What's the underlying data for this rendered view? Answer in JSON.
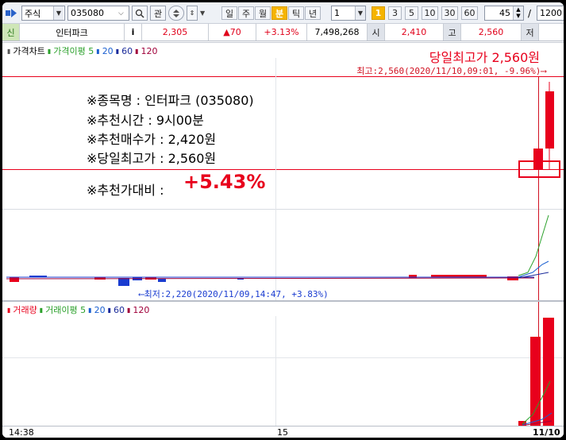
{
  "toolbar": {
    "market_type": "주식",
    "code": "035080",
    "btn_interest": "관",
    "periods": [
      "일",
      "주",
      "월",
      "분",
      "틱",
      "년"
    ],
    "active_period": "분",
    "unit_value": "1",
    "minute_options": [
      "1",
      "3",
      "5",
      "10",
      "30",
      "60"
    ],
    "active_minute": "1",
    "count_value": "45",
    "slash": "/",
    "total_value": "1200"
  },
  "quote": {
    "credit_label": "신",
    "name": "인터파크",
    "info_icon": "i",
    "price": "2,305",
    "change": "▲70",
    "change_pct": "+3.13%",
    "volume": "7,498,268",
    "open_label": "시",
    "open": "2,410",
    "high_label": "고",
    "high": "2,560",
    "low_label": "저"
  },
  "price_panel": {
    "legend_title": "가격차트",
    "legend_ma": "가격이평 5",
    "ma_20": "20",
    "ma_60": "60",
    "ma_120": "120",
    "today_high_title": "당일최고가 2,560원",
    "max_label": "최고:2,560(2020/11/10,09:01, -9.96%)⟶",
    "min_label": "⟵최저:2,220(2020/11/09,14:47, +3.83%)"
  },
  "annotation": {
    "line1": "※종목명 : 인터파크 (035080)",
    "line2": "※추천시간 : 9시00분",
    "line3": "※추천매수가 : 2,420원",
    "line4": "※당일최고가 : 2,560원",
    "line5_label": "※추천가대비 : ",
    "line5_value": "+5.43%"
  },
  "volume_panel": {
    "legend_title": "거래량",
    "legend_ma": "거래이평 5",
    "ma_20": "20",
    "ma_60": "60",
    "ma_120": "120"
  },
  "x_axis": [
    "14:38",
    "15",
    "11/10"
  ],
  "colors": {
    "up": "#e8001c",
    "down": "#1a3cd0",
    "ma5": "#2aa02a",
    "ma20": "#1a5fd0",
    "ma60": "#1a2a9a",
    "ma120": "#a0003a",
    "highlight": "#f5b400"
  }
}
